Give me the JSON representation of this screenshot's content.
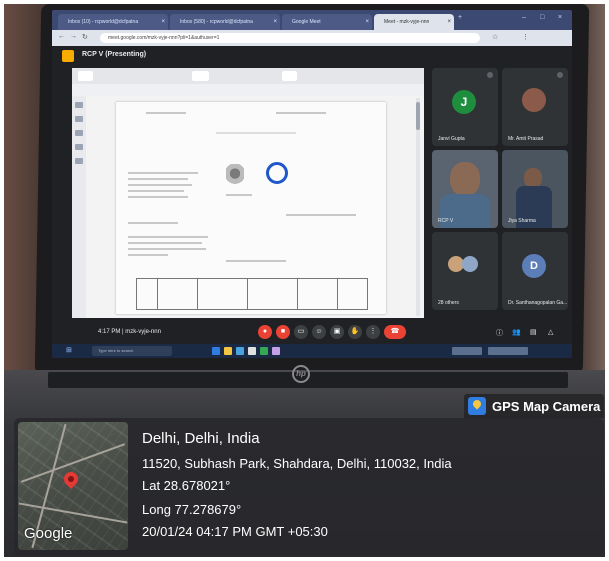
{
  "browser": {
    "tabs": [
      {
        "label": "Inbox (10) - rcpworld@dcfpatna"
      },
      {
        "label": "Inbox (580) - rcpworld@dcfpatna"
      },
      {
        "label": "Google Meet"
      },
      {
        "label": "Meet - mzk-vyje-nnn"
      }
    ],
    "url": "meet.google.com/mzk-vyje-nnn?pli=1&authuser=1"
  },
  "meet": {
    "presenting_label": "RCP V (Presenting)",
    "participants": [
      {
        "name": "Janvi Gupta",
        "initial": "J"
      },
      {
        "name": "Mr. Amit Prasad"
      },
      {
        "name": "RCP V"
      },
      {
        "name": "Jiya Sharma"
      },
      {
        "name": "28 others"
      },
      {
        "name": "Dr. Santhanagopalan Ga...",
        "initial": "D"
      }
    ],
    "time": "4:17 PM | mzk-vyje-nnn"
  },
  "taskbar": {
    "search_placeholder": "Type here to search"
  },
  "gps": {
    "app_name": "GPS Map Camera",
    "city_line": "Delhi, Delhi, India",
    "address": "11520, Subhash Park, Shahdara, Delhi, 110032, India",
    "lat": "Lat 28.678021°",
    "long": "Long 77.278679°",
    "datetime": "20/01/24 04:17 PM GMT +05:30",
    "map_brand": "Google"
  },
  "colors": {
    "meet_bg": "#202124",
    "leave_red": "#ea4335",
    "gps_icon_blue": "#2f7de1"
  }
}
